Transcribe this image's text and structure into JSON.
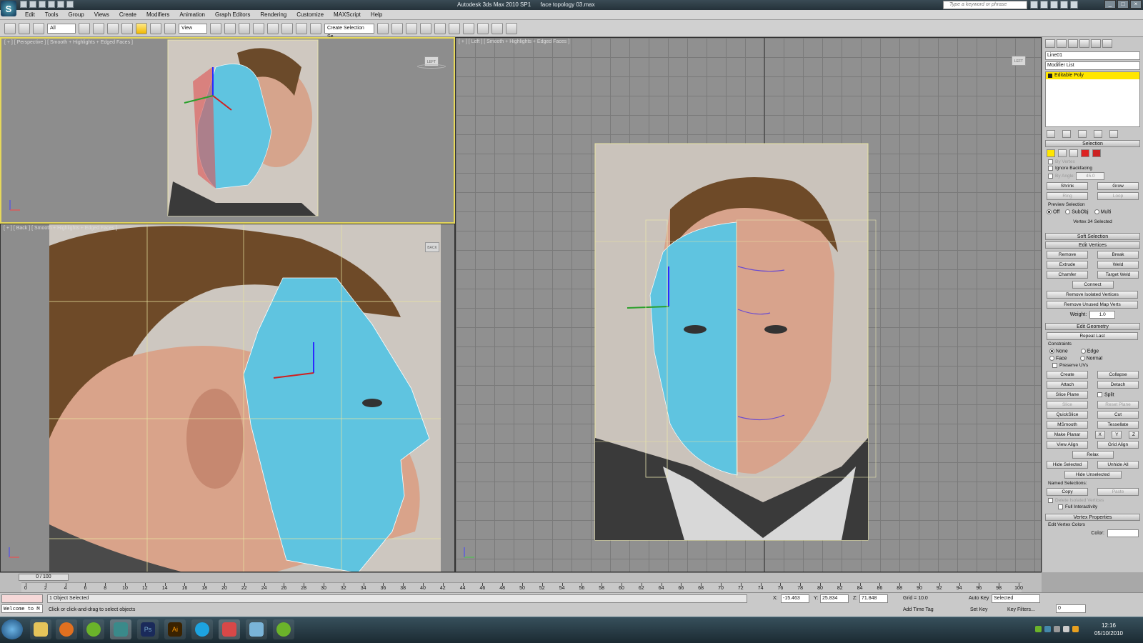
{
  "title": {
    "app": "Autodesk 3ds Max 2010 SP1",
    "file": "face topology 03.max",
    "search_placeholder": "Type a keyword or phrase"
  },
  "menus": [
    "Edit",
    "Tools",
    "Group",
    "Views",
    "Create",
    "Modifiers",
    "Animation",
    "Graph Editors",
    "Rendering",
    "Customize",
    "MAXScript",
    "Help"
  ],
  "toolbar": {
    "filter": "All",
    "refcoord": "View",
    "named_selection": "Create Selection Se"
  },
  "viewports": {
    "perspective": {
      "label": "[ + ] [ Perspective ] [ Smooth + Highlights + Edged Faces ]",
      "cube": "LEFT"
    },
    "back": {
      "label": "[ + ] [ Back ] [ Smooth + Highlights + Edged Faces ]",
      "cube": "BACK"
    },
    "left": {
      "label": "[ + ] [ Left ] [ Smooth + Highlights + Edged Faces ]",
      "cube": "LEFT"
    }
  },
  "command_panel": {
    "object_name": "Line01",
    "modifier_list": "Modifier List",
    "stack_item": "Editable Poly",
    "selection": {
      "title": "Selection",
      "by_vertex": "By Vertex",
      "ignore_backfacing": "Ignore Backfacing",
      "by_angle": "By Angle:",
      "by_angle_value": "45.0",
      "shrink": "Shrink",
      "grow": "Grow",
      "ring": "Ring",
      "loop": "Loop",
      "preview": "Preview Selection",
      "off": "Off",
      "subobj": "SubObj",
      "multi": "Multi",
      "status": "Vertex 34 Selected"
    },
    "soft_selection": "Soft Selection",
    "edit_vertices": {
      "title": "Edit Vertices",
      "remove": "Remove",
      "break": "Break",
      "extrude": "Extrude",
      "weld": "Weld",
      "chamfer": "Chamfer",
      "target_weld": "Target Weld",
      "connect": "Connect",
      "remove_isolated": "Remove Isolated Vertices",
      "remove_unused": "Remove Unused Map Verts",
      "weight_label": "Weight:",
      "weight_value": "1.0"
    },
    "edit_geometry": {
      "title": "Edit Geometry",
      "repeat_last": "Repeat Last",
      "constraints": "Constraints",
      "none": "None",
      "edge": "Edge",
      "face": "Face",
      "normal": "Normal",
      "preserve_uvs": "Preserve UVs",
      "create": "Create",
      "collapse": "Collapse",
      "attach": "Attach",
      "detach": "Detach",
      "slice_plane": "Slice Plane",
      "split": "Split",
      "slice": "Slice",
      "reset_plane": "Reset Plane",
      "quickslice": "QuickSlice",
      "cut": "Cut",
      "msmooth": "MSmooth",
      "tessellate": "Tessellate",
      "make_planar": "Make Planar",
      "x": "X",
      "y": "Y",
      "z": "Z",
      "view_align": "View Align",
      "grid_align": "Grid Align",
      "relax": "Relax",
      "hide_selected": "Hide Selected",
      "unhide_all": "Unhide All",
      "hide_unselected": "Hide Unselected",
      "named_selections": "Named Selections:",
      "copy": "Copy",
      "paste": "Paste",
      "delete_isolated": "Delete Isolated Vertices",
      "full_interactivity": "Full Interactivity"
    },
    "vertex_properties": {
      "title": "Vertex Properties",
      "edit_colors": "Edit Vertex Colors",
      "color": "Color:"
    }
  },
  "timeline": {
    "slider": "0 / 100",
    "ticks": [
      "0",
      "2",
      "4",
      "6",
      "8",
      "10",
      "12",
      "14",
      "16",
      "18",
      "20",
      "22",
      "24",
      "26",
      "28",
      "30",
      "32",
      "34",
      "36",
      "38",
      "40",
      "42",
      "44",
      "46",
      "48",
      "50",
      "52",
      "54",
      "56",
      "58",
      "60",
      "62",
      "64",
      "66",
      "68",
      "70",
      "72",
      "74",
      "76",
      "78",
      "80",
      "82",
      "84",
      "86",
      "88",
      "90",
      "92",
      "94",
      "96",
      "98",
      "100"
    ]
  },
  "status": {
    "listener": "Welcome to M",
    "selected": "1 Object Selected",
    "prompt": "Click or click-and-drag to select objects",
    "x_label": "X:",
    "x": "-15.463",
    "y_label": "Y:",
    "y": "25.834",
    "z_label": "Z:",
    "z": "71.848",
    "grid": "Grid = 10.0",
    "add_time_tag": "Add Time Tag",
    "auto_key": "Auto Key",
    "set_key": "Set Key",
    "selected_dd": "Selected",
    "key_filters": "Key Filters...",
    "frame": "0"
  },
  "taskbar": {
    "time": "12:16",
    "date": "05/10/2010",
    "ps": "Ps",
    "ai": "Ai"
  }
}
